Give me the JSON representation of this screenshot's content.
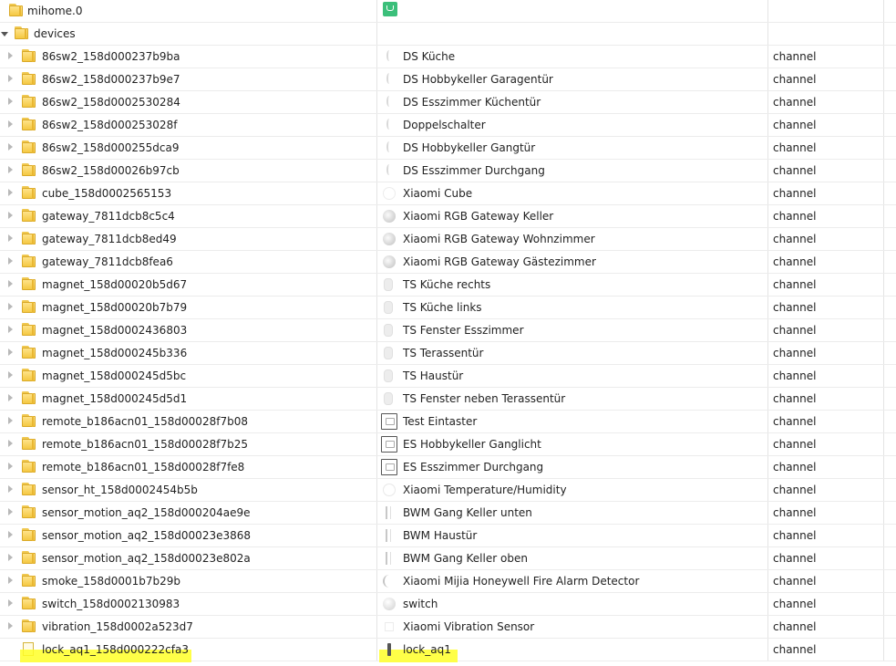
{
  "root": {
    "id": "mihome.0",
    "icon": "mihome-logo-icon"
  },
  "devices_folder": {
    "id": "devices"
  },
  "rows": [
    {
      "id": "86sw2_158d000237b9ba",
      "name": "DS Küche",
      "type": "channel",
      "icon": "switch-ico"
    },
    {
      "id": "86sw2_158d000237b9e7",
      "name": "DS Hobbykeller Garagentür",
      "type": "channel",
      "icon": "switch-ico"
    },
    {
      "id": "86sw2_158d0002530284",
      "name": "DS Esszimmer Küchentür",
      "type": "channel",
      "icon": "switch-ico"
    },
    {
      "id": "86sw2_158d000253028f",
      "name": "Doppelschalter",
      "type": "channel",
      "icon": "switch-ico"
    },
    {
      "id": "86sw2_158d000255dca9",
      "name": "DS Hobbykeller Gangtür",
      "type": "channel",
      "icon": "switch-ico"
    },
    {
      "id": "86sw2_158d00026b97cb",
      "name": "DS Esszimmer Durchgang",
      "type": "channel",
      "icon": "switch-ico"
    },
    {
      "id": "cube_158d0002565153",
      "name": "Xiaomi Cube",
      "type": "channel",
      "icon": "cube-ico"
    },
    {
      "id": "gateway_7811dcb8c5c4",
      "name": "Xiaomi RGB Gateway Keller",
      "type": "channel",
      "icon": "gateway-ico"
    },
    {
      "id": "gateway_7811dcb8ed49",
      "name": "Xiaomi RGB Gateway Wohnzimmer",
      "type": "channel",
      "icon": "gateway-ico"
    },
    {
      "id": "gateway_7811dcb8fea6",
      "name": "Xiaomi RGB Gateway Gästezimmer",
      "type": "channel",
      "icon": "gateway-ico"
    },
    {
      "id": "magnet_158d00020b5d67",
      "name": "TS Küche rechts",
      "type": "channel",
      "icon": "magnet-ico"
    },
    {
      "id": "magnet_158d00020b7b79",
      "name": "TS Küche links",
      "type": "channel",
      "icon": "magnet-ico"
    },
    {
      "id": "magnet_158d0002436803",
      "name": "TS Fenster Esszimmer",
      "type": "channel",
      "icon": "magnet-ico"
    },
    {
      "id": "magnet_158d000245b336",
      "name": "TS Terassentür",
      "type": "channel",
      "icon": "magnet-ico"
    },
    {
      "id": "magnet_158d000245d5bc",
      "name": "TS Haustür",
      "type": "channel",
      "icon": "magnet-ico"
    },
    {
      "id": "magnet_158d000245d5d1",
      "name": "TS Fenster neben Terassentür",
      "type": "channel",
      "icon": "magnet-ico"
    },
    {
      "id": "remote_b186acn01_158d00028f7b08",
      "name": "Test Eintaster",
      "type": "channel",
      "icon": "remote-ico"
    },
    {
      "id": "remote_b186acn01_158d00028f7b25",
      "name": "ES Hobbykeller Ganglicht",
      "type": "channel",
      "icon": "remote-ico"
    },
    {
      "id": "remote_b186acn01_158d00028f7fe8",
      "name": "ES Esszimmer Durchgang",
      "type": "channel",
      "icon": "remote-ico"
    },
    {
      "id": "sensor_ht_158d0002454b5b",
      "name": "Xiaomi Temperature/Humidity",
      "type": "channel",
      "icon": "sensorht-ico"
    },
    {
      "id": "sensor_motion_aq2_158d000204ae9e",
      "name": "BWM Gang Keller unten",
      "type": "channel",
      "icon": "motion-ico"
    },
    {
      "id": "sensor_motion_aq2_158d00023e3868",
      "name": "BWM Haustür",
      "type": "channel",
      "icon": "motion-ico"
    },
    {
      "id": "sensor_motion_aq2_158d00023e802a",
      "name": "BWM Gang Keller oben",
      "type": "channel",
      "icon": "motion-ico"
    },
    {
      "id": "smoke_158d0001b7b29b",
      "name": "Xiaomi Mijia Honeywell Fire Alarm Detector",
      "type": "channel",
      "icon": "smoke-ico"
    },
    {
      "id": "switch_158d0002130983",
      "name": "switch",
      "type": "channel",
      "icon": "switchround-ico"
    },
    {
      "id": "vibration_158d0002a523d7",
      "name": "Xiaomi Vibration Sensor",
      "type": "channel",
      "icon": "vibration-ico"
    },
    {
      "id": "lock_aq1_158d000222cfa3",
      "name": "lock_aq1",
      "type": "channel",
      "icon": "lock-ico",
      "highlight": true,
      "leaf": true
    }
  ],
  "colors": {
    "highlight": "#ffff28",
    "folder": "#f5c842",
    "mihome_logo": "#3bbf7a"
  }
}
